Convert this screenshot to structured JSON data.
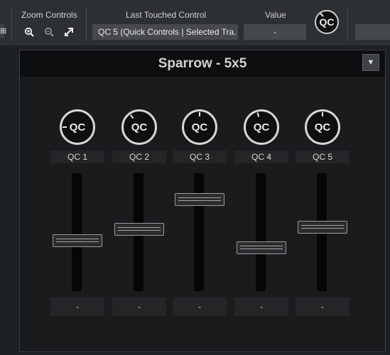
{
  "toolbar": {
    "edge_button_glyph": "⊞",
    "zoom": {
      "label": "Zoom Controls",
      "buttons": [
        {
          "name": "zoom-in-icon",
          "glyph": "⊕"
        },
        {
          "name": "zoom-out-icon",
          "glyph": "⊖"
        },
        {
          "name": "fit-icon",
          "glyph": "⤢"
        }
      ]
    },
    "last_touched": {
      "label": "Last Touched Control",
      "value": "QC 5 (Quick Controls | Selected Tra."
    },
    "value": {
      "label": "Value",
      "value": "-"
    },
    "qc_button_label": "QC"
  },
  "panel": {
    "title": "Sparrow - 5x5",
    "menu_glyph": "▼"
  },
  "strips": [
    {
      "knob_label": "QC",
      "name": "QC 1",
      "value": "-",
      "fader_level": 0.42,
      "knob_angle": -90
    },
    {
      "knob_label": "QC",
      "name": "QC 2",
      "value": "-",
      "fader_level": 0.53,
      "knob_angle": -35
    },
    {
      "knob_label": "QC",
      "name": "QC 3",
      "value": "-",
      "fader_level": 0.81,
      "knob_angle": 0
    },
    {
      "knob_label": "QC",
      "name": "QC 4",
      "value": "-",
      "fader_level": 0.35,
      "knob_angle": -15
    },
    {
      "knob_label": "QC",
      "name": "QC 5",
      "value": "-",
      "fader_level": 0.55,
      "knob_angle": 0
    }
  ],
  "colors": {
    "background": "#1e2124",
    "toolbar": "#2d3033",
    "panel_header": "#0d0e0f",
    "fader_track": "#060606"
  }
}
